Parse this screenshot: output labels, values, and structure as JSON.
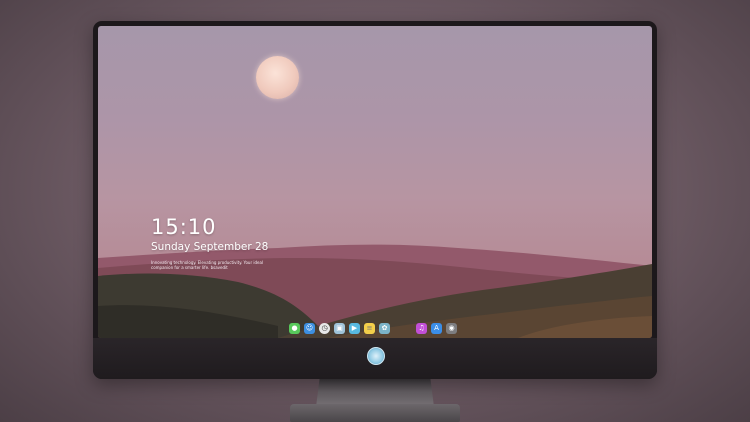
{
  "lock_screen": {
    "time": "15:10",
    "date": "Sunday September 28",
    "tagline": "Innovating technology. Elevating productivity. Your ideal companion for a smarter life. bsavedit"
  },
  "dock": {
    "apps": [
      {
        "name": "messages",
        "icon": "chat-icon",
        "color": "#58c95b"
      },
      {
        "name": "finder",
        "icon": "finder-icon",
        "color": "#3d8fe0"
      },
      {
        "name": "clock",
        "icon": "clock-icon",
        "color": "#e8e8e8"
      },
      {
        "name": "preview",
        "icon": "preview-icon",
        "color": "#9fc3d8"
      },
      {
        "name": "video",
        "icon": "clapper-icon",
        "color": "#58b9e0"
      },
      {
        "name": "notes",
        "icon": "notes-icon",
        "color": "#f4cf4a"
      },
      {
        "name": "photos",
        "icon": "photos-icon",
        "color": "#7bb3c8"
      },
      {
        "name": "music",
        "icon": "music-icon",
        "color": "#c24fd6"
      },
      {
        "name": "app-store",
        "icon": "app-store-icon",
        "color": "#3b8ee8"
      },
      {
        "name": "camera",
        "icon": "camera-icon",
        "color": "#7d7d80"
      }
    ]
  }
}
